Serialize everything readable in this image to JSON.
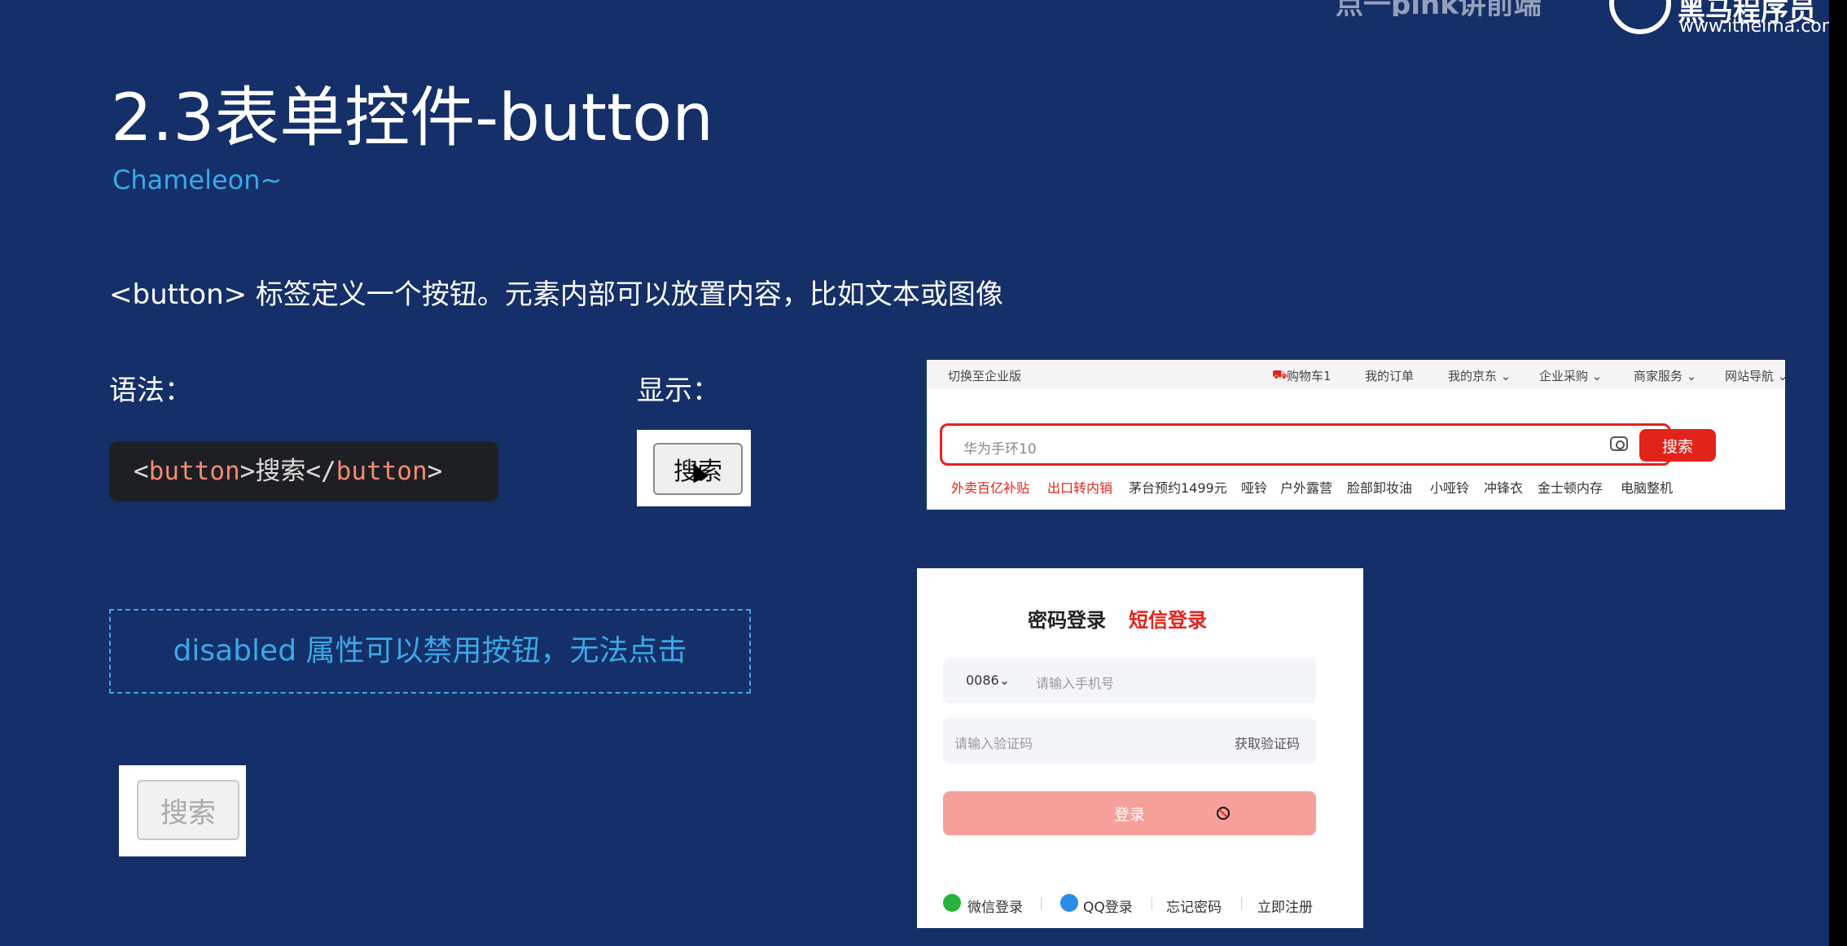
{
  "brand": {
    "name": "黑马程序员",
    "url": "www.itheima.com",
    "top_text": "点一pink讲前端"
  },
  "slide": {
    "title": "2.3表单控件-button",
    "subtitle": "Chameleon~",
    "description": "<button> 标签定义一个按钮。元素内部可以放置内容，比如文本或图像",
    "syntax_label": "语法：",
    "display_label": "显示：",
    "code": {
      "open_bracket": "<",
      "tag": "button",
      "close_bracket": ">",
      "inner": "搜索",
      "end_open": "</",
      "end_tag": "button",
      "end_close": ">"
    },
    "demo_button": "搜索",
    "disabled_note": "disabled 属性可以禁用按钮，无法点击",
    "disabled_button": "搜索"
  },
  "jd_header": {
    "top_bar": [
      "切换至企业版",
      "购物车1",
      "我的订单",
      "我的京东 ⌄",
      "企业采购 ⌄",
      "商家服务 ⌄",
      "网站导航 ⌄"
    ],
    "search_placeholder": "华为手环10",
    "search_button": "搜索",
    "hot_links": [
      "外卖百亿补贴",
      "出口转内销",
      "茅台预约1499元",
      "哑铃",
      "户外露营",
      "脸部卸妆油",
      "小哑铃",
      "冲锋衣",
      "金士顿内存",
      "电脑整机"
    ],
    "accent": "#e2231a"
  },
  "login": {
    "tab_password": "密码登录",
    "tab_sms": "短信登录",
    "country_code": "0086⌄",
    "phone_placeholder": "请输入手机号",
    "code_placeholder": "请输入验证码",
    "get_code": "获取验证码",
    "login_button": "登录",
    "footer": [
      "微信登录",
      "QQ登录",
      "忘记密码",
      "立即注册"
    ]
  }
}
